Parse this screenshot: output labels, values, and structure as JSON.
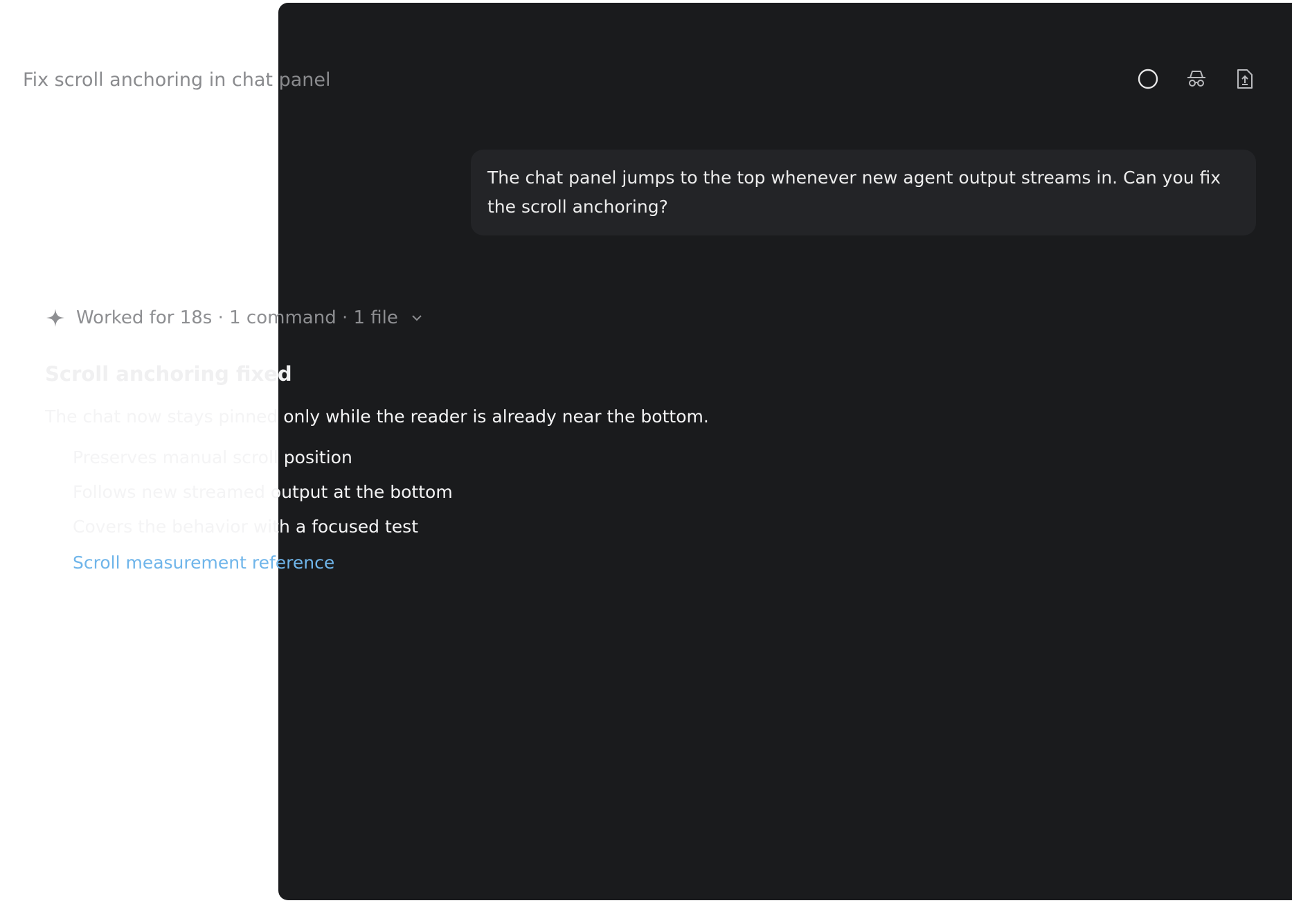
{
  "header": {
    "title": "Fix scroll anchoring in chat panel",
    "icons": [
      "circle-icon",
      "incognito-icon",
      "file-upload-icon"
    ]
  },
  "user_message": {
    "text": "The chat panel jumps to the top whenever new agent output streams in. Can you fix the scroll anchoring?"
  },
  "worked": {
    "label": "Worked for 18s · 1 command · 1 file"
  },
  "summary": {
    "heading": "Scroll anchoring fixed",
    "text": "The chat now stays pinned only while the reader is already near the bottom.",
    "bullets": [
      "Preserves manual scroll position",
      "Follows new streamed output at the bottom",
      "Covers the behavior with a focused test"
    ],
    "link": "Scroll measurement reference"
  },
  "colors": {
    "panel": "#1a1b1d",
    "bubble": "#232427",
    "link": "#6fb5ea"
  }
}
